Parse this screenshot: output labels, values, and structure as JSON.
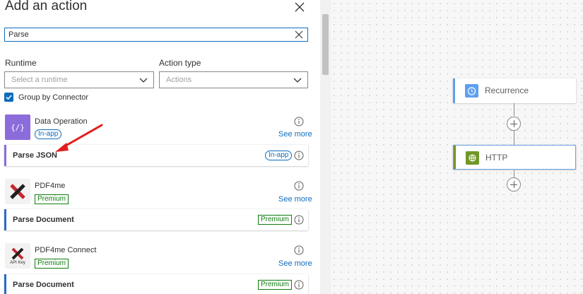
{
  "panel": {
    "title": "Add an action",
    "search": {
      "value": "Parse",
      "placeholder": ""
    },
    "runtime": {
      "label": "Runtime",
      "placeholder": "Select a runtime"
    },
    "action_type": {
      "label": "Action type",
      "placeholder": "Actions"
    },
    "group_by_connector": {
      "label": "Group by Connector",
      "checked": true
    },
    "see_more": "See more",
    "connectors": [
      {
        "name": "Data Operation",
        "badge": "In-app",
        "icon": "data-operation-icon",
        "actions": [
          {
            "label": "Parse JSON",
            "badge": "In-app"
          }
        ]
      },
      {
        "name": "PDF4me",
        "badge": "Premium",
        "icon": "pdf4me-icon",
        "actions": [
          {
            "label": "Parse Document",
            "badge": "Premium"
          }
        ]
      },
      {
        "name": "PDF4me Connect",
        "badge": "Premium",
        "icon": "pdf4me-connect-icon",
        "icon_caption": "API Key",
        "actions": [
          {
            "label": "Parse Document",
            "badge": "Premium"
          }
        ]
      }
    ]
  },
  "canvas": {
    "nodes": [
      {
        "label": "Recurrence",
        "icon": "clock-icon",
        "accent": "#5ea0ef"
      },
      {
        "label": "HTTP",
        "icon": "globe-icon",
        "accent": "#709727"
      }
    ]
  },
  "colors": {
    "link": "#0f6cbd",
    "premium": "#107c10",
    "data_operation": "#8c6cdb",
    "arrow": "#e02020"
  }
}
